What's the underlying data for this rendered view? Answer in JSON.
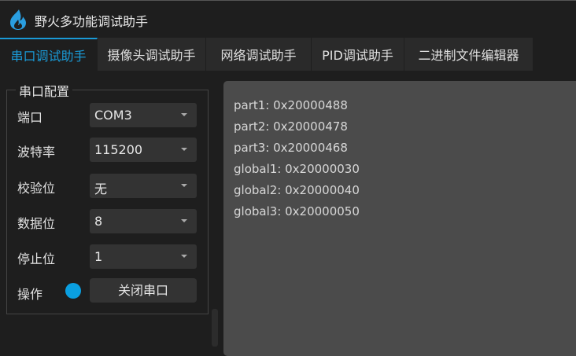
{
  "app": {
    "title": "野火多功能调试助手"
  },
  "tabs": [
    {
      "label": "串口调试助手"
    },
    {
      "label": "摄像头调试助手"
    },
    {
      "label": "网络调试助手"
    },
    {
      "label": "PID调试助手"
    },
    {
      "label": "二进制文件编辑器"
    }
  ],
  "serial": {
    "group_title": "串口配置",
    "fields": [
      {
        "label": "端口",
        "value": "COM3"
      },
      {
        "label": "波特率",
        "value": "115200"
      },
      {
        "label": "校验位",
        "value": "无"
      },
      {
        "label": "数据位",
        "value": "8"
      },
      {
        "label": "停止位",
        "value": "1"
      }
    ],
    "action_label": "操作",
    "action_button": "关闭串口",
    "status_color": "#0a9fe0"
  },
  "output": {
    "lines": [
      "part1: 0x20000488",
      "part2: 0x20000478",
      "part3: 0x20000468",
      "global1: 0x20000030",
      "global2: 0x20000040",
      "global3: 0x20000050"
    ]
  }
}
